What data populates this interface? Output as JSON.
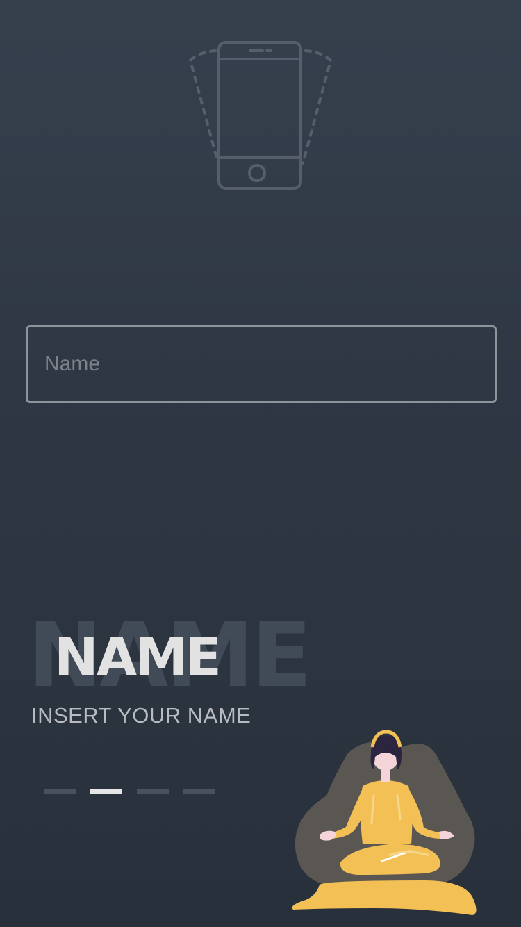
{
  "icons": {
    "phone": "phone-shake-icon",
    "illustration": "meditation-illustration"
  },
  "form": {
    "name_placeholder": "Name",
    "name_value": ""
  },
  "heading": {
    "background_text": "NAME",
    "title": "NAME",
    "subtitle": "INSERT YOUR NAME"
  },
  "pager": {
    "total": 4,
    "active_index": 1
  },
  "colors": {
    "background_top": "#36404d",
    "background_bottom": "#28303b",
    "accent_yellow": "#f3c055",
    "title": "#e2e2e2",
    "pager_active": "#e6e6e6",
    "pager_inactive": "#48515d"
  }
}
